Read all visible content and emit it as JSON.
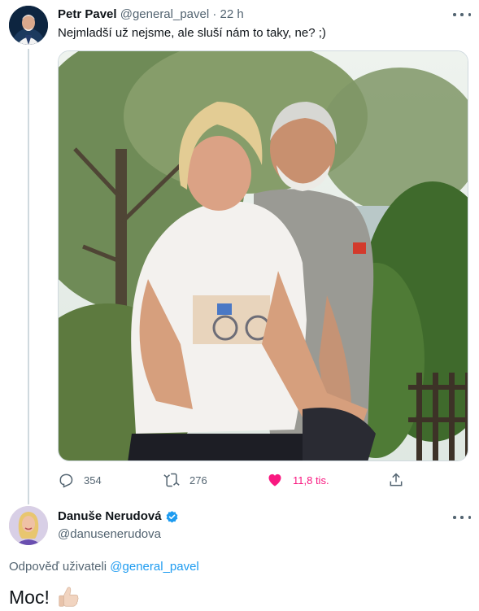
{
  "tweet": {
    "author_name": "Petr Pavel",
    "author_handle": "@general_pavel",
    "separator": "·",
    "time": "22 h",
    "text": "Nejmladší už nejsme, ale sluší nám to taky, ne? ;)",
    "stats": {
      "replies": "354",
      "retweets": "276",
      "likes": "11,8 tis."
    },
    "liked": true
  },
  "reply": {
    "author_name": "Danuše Nerudová",
    "author_handle": "@danusenerudova",
    "verified": true,
    "replying_prefix": "Odpověď uživateli",
    "replying_to": "@general_pavel",
    "text": "Moc!"
  },
  "colors": {
    "like": "#f91880",
    "link": "#1d9bf0",
    "muted": "#536471",
    "verified": "#1d9bf0"
  }
}
